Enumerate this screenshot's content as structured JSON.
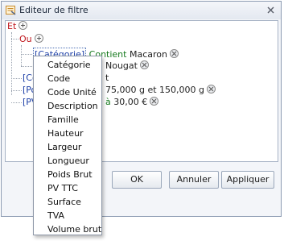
{
  "window": {
    "title": "Editeur de filtre"
  },
  "tree": {
    "root_group": "Et",
    "sub_group": "Ou",
    "row1": {
      "field": "[Catégorie]",
      "op": "Contient",
      "value": "Macaron"
    },
    "row2": {
      "value": "Nougat"
    },
    "row3": {
      "field": "[Coc",
      "value": "t"
    },
    "row4": {
      "field": "[Poid",
      "value": "75,000 g et 150,000 g"
    },
    "row5": {
      "field": "[PV T",
      "op": "à",
      "value": "30,00 €"
    }
  },
  "buttons": {
    "ok": "OK",
    "cancel": "Annuler",
    "apply": "Appliquer"
  },
  "menu": {
    "items": [
      "Catégorie",
      "Code",
      "Code Unité",
      "Description",
      "Famille",
      "Hauteur",
      "Largeur",
      "Longueur",
      "Poids Brut",
      "PV TTC",
      "Surface",
      "TVA",
      "Volume brut"
    ]
  }
}
